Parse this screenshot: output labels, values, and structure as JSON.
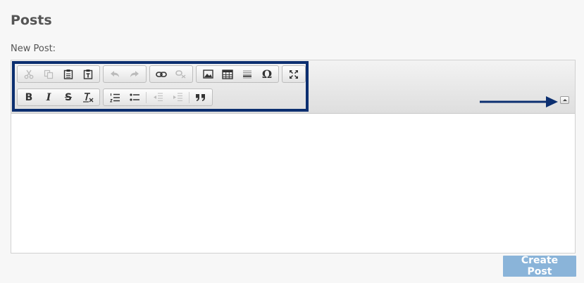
{
  "page": {
    "title": "Posts",
    "new_post_label": "New Post:"
  },
  "toolbar": {
    "row1": [
      {
        "group": "clipboard",
        "buttons": [
          "cut-icon",
          "copy-icon",
          "paste-icon",
          "paste-text-icon"
        ]
      },
      {
        "group": "history",
        "buttons": [
          "undo-icon",
          "redo-icon"
        ]
      },
      {
        "group": "links",
        "buttons": [
          "link-icon",
          "unlink-icon"
        ]
      },
      {
        "group": "insert",
        "buttons": [
          "image-icon",
          "table-icon",
          "horizontal-line-icon",
          "special-char-icon"
        ]
      },
      {
        "group": "tools",
        "buttons": [
          "maximize-icon"
        ]
      }
    ],
    "row2": [
      {
        "group": "basicstyles",
        "buttons": [
          "bold-icon",
          "italic-icon",
          "strike-icon",
          "remove-format-icon"
        ]
      },
      {
        "group": "paragraph",
        "buttons": [
          "numbered-list-icon",
          "bulleted-list-icon",
          "outdent-icon",
          "indent-icon",
          "blockquote-icon"
        ]
      }
    ],
    "bold_glyph": "B",
    "italic_glyph": "I",
    "strike_glyph": "S",
    "omega_glyph": "Ω",
    "quote_glyph": "❞❞"
  },
  "editor": {
    "content": ""
  },
  "actions": {
    "create_label": "Create Post"
  },
  "colors": {
    "highlight": "#0c2f70",
    "button": "#8ab4d9"
  }
}
